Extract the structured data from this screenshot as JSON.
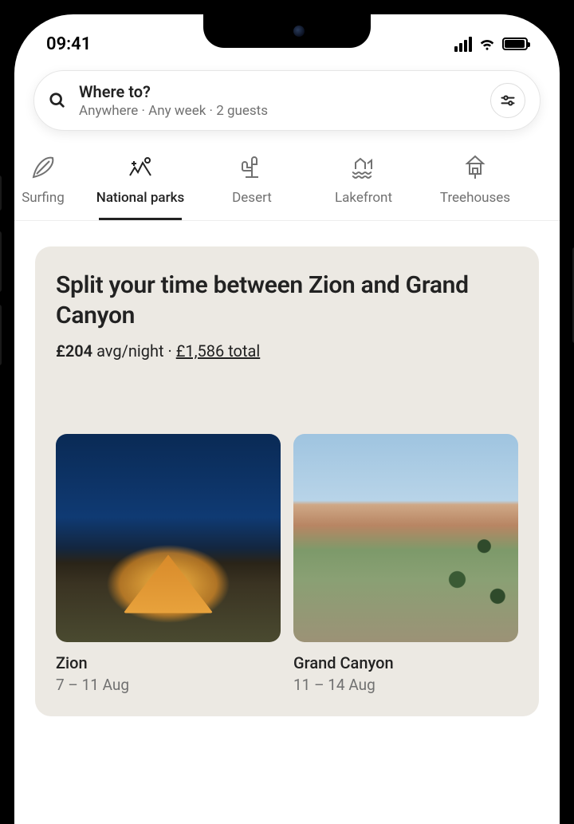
{
  "status": {
    "time": "09:41"
  },
  "search": {
    "title": "Where to?",
    "subtitle": "Anywhere · Any week · 2 guests"
  },
  "categories": [
    {
      "id": "surfing",
      "label": "Surfing",
      "active": false
    },
    {
      "id": "national-parks",
      "label": "National parks",
      "active": true
    },
    {
      "id": "desert",
      "label": "Desert",
      "active": false
    },
    {
      "id": "lakefront",
      "label": "Lakefront",
      "active": false
    },
    {
      "id": "treehouses",
      "label": "Treehouses",
      "active": false
    }
  ],
  "split_card": {
    "title": "Split your time between Zion and Grand Canyon",
    "avg_price": "£204",
    "avg_suffix": "avg/night",
    "separator": " · ",
    "total_price": "£1,586 total",
    "stays": [
      {
        "name": "Zion",
        "dates": "7 – 11 Aug"
      },
      {
        "name": "Grand Canyon",
        "dates": "11 – 14 Aug"
      }
    ]
  }
}
